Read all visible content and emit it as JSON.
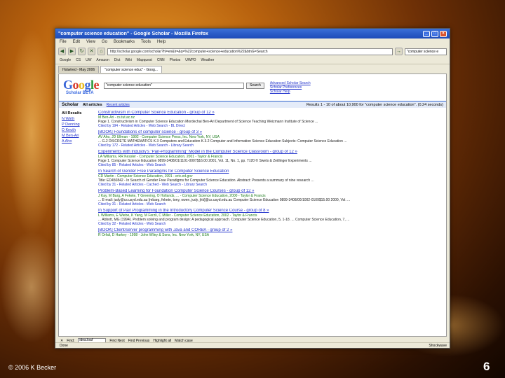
{
  "window": {
    "title": "\"computer science education\" - Google Scholar - Mozilla Firefox"
  },
  "menu": [
    "File",
    "Edit",
    "View",
    "Go",
    "Bookmarks",
    "Tools",
    "Help"
  ],
  "nav": {
    "url": "http://scholar.google.com/scholar?hl=en&lr=&q=%22computer+science+education%22&btnG=Search",
    "search_value": "\"computer science e"
  },
  "bookmarks": [
    "Google",
    "CS",
    "UW",
    "Amazon",
    "Dict",
    "Wiki",
    "Mapquest",
    "CNN",
    "Photos",
    "UWPD",
    "Weather"
  ],
  "tabs": [
    "Hotwired - May 2006",
    "\"computer science educ\" - Goog..."
  ],
  "scholar": {
    "query": "\"computer science education\"",
    "search_label": "Search",
    "adv_search": "Advanced Scholar Search",
    "preferences": "Scholar Preferences",
    "help": "Scholar Help",
    "section": "Scholar",
    "all_articles": "All articles",
    "recent_articles": "Recent articles",
    "results_count": "Results 1 - 10 of about 10,900 for \"computer science education\". (0.24 seconds)"
  },
  "sidebar": {
    "head": "All Results",
    "items": [
      "N Wirth",
      "P Denning",
      "D Knuth",
      "M Ben-Ari",
      "A Aho"
    ]
  },
  "results": [
    {
      "title": "Constructivism in Computer Science Education - group of 12 »",
      "author": "M Ben-Ari - cs.tut.ac.nz",
      "snippet": "Page 1. Constructivism in Computer Science Education Mordechai Ben-Ari Department of Science Teaching Weizmann Institute of Science ...",
      "cited": "Cited by 194 - Related Articles - Web Search - BL Direct"
    },
    {
      "title": "[BOOK] Foundations of computer science - group of 3 »",
      "author": "AV Aho, JD Ullman - 1992 - Computer Science Press, Inc. New York, NY, USA",
      "snippet": "... G.2 DISCRETE MATHEMATICS K.3 Computers and Education K.3.2 Computer and Information Science Education Subjects: Computer Science Education ...",
      "cited": "Cited by 172 - Related Articles - Web Search - Library Search"
    },
    {
      "title": "Experiments with Industry's \"Pair-Programming\" Model in the Computer Science Classroom - group of 12 »",
      "author": "LA Williams, RR Kessler - Computer Science Education, 2001 - Taylor & Francis",
      "snippet": "Page 1. Computer Science Education 0899-3408/01/1101-0007$16.00 2001, Vol. 11, No. 1, pp. 7±20 © Swets & Zeitlinger Experiments ...",
      "cited": "Cited by 85 - Related Articles - Web Search"
    },
    {
      "title": "In Search of Gender Free Paradigms for Computer Science Education",
      "author": "CD Martin - Computer Science Education, 1991 - eric.ed.gov",
      "snippet": "Title: ED450842 - In Search of Gender Free Paradigms for Computer Science Education. Abstract: Presents a summary of nine research ...",
      "cited": "Cited by 31 - Related Articles - Cached - Web Search - Library Search"
    },
    {
      "title": "Problem-Based Learning for Foundation Computer Science Courses - group of 12 »",
      "author": "J Kay, M Barg, A Fekete, T Greening, O Hollands, ... - Computer Science Education, 2000 - Taylor & Francis",
      "snippet": "... E-mail: judy@cs.usyd.edu.au [mbarg, fekete, tony, owen, judy, jhk]@cs.usyd.edu.au Computer Science Education 0899-3408/00/1002-0109$15.00 2000, Vol. ...",
      "cited": "Cited by 31 - Related Articles - Web Search"
    },
    {
      "title": "In Support of Pair Programming in the Introductory Computer Science Course - group of 8 »",
      "author": "L Williams, E Wiebe, K Yang, M Ferzli, C Miller - Computer Science Education, 2002 - Taylor & Francis",
      "snippet": "... Abbott, MG (1994). Problem solving and program design: A pedagogical approach. Computer Science Education, 5, 1-18. ... Computer Science Education, 7, ...",
      "cited": "Cited by 32 - Related Articles - Web Search"
    },
    {
      "title": "[BOOK] Client/server programming with Java and CORBA - group of 2 »",
      "author": "R Orfali, D Harkey - 1998 - John Wiley & Sons, Inc. New York, NY, USA",
      "snippet": "",
      "cited": ""
    }
  ],
  "findbar": {
    "label": "Find:",
    "value": "idea.loaf",
    "find_next": "Find Next",
    "find_prev": "Find Previous",
    "highlight": "Highlight all",
    "match_case": "Match case"
  },
  "status": {
    "left": "Done",
    "right": "Shockwave"
  },
  "footer": {
    "copyright": "© 2006 K Becker",
    "page": "6"
  }
}
